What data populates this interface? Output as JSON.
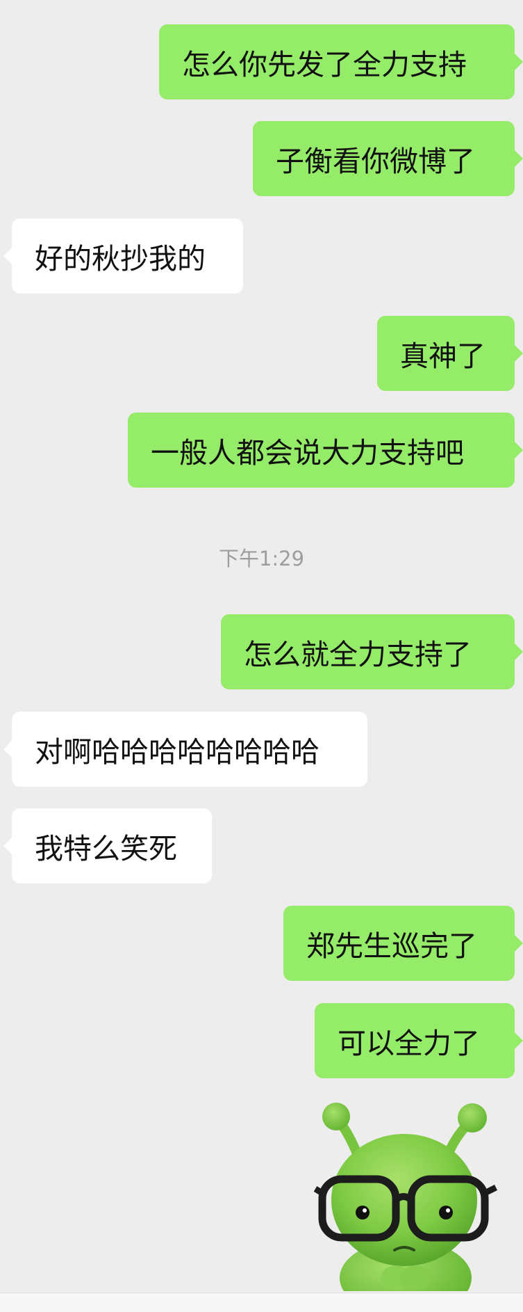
{
  "colors": {
    "background": "#ededed",
    "outgoing_bubble": "#95ec69",
    "incoming_bubble": "#ffffff",
    "timestamp_text": "#9d9d9d"
  },
  "messages": [
    {
      "direction": "out",
      "text": "怎么你先发了全力支持"
    },
    {
      "direction": "out",
      "text": "子衡看你微博了"
    },
    {
      "direction": "in",
      "text": "好的秋抄我的"
    },
    {
      "direction": "out",
      "text": "真神了"
    },
    {
      "direction": "out",
      "text": "一般人都会说大力支持吧"
    },
    {
      "direction": "out",
      "text": "怎么就全力支持了"
    },
    {
      "direction": "in",
      "text": "对啊哈哈哈哈哈哈哈哈"
    },
    {
      "direction": "in",
      "text": "我特么笑死"
    },
    {
      "direction": "out",
      "text": "郑先生巡完了"
    },
    {
      "direction": "out",
      "text": "可以全力了"
    }
  ],
  "timestamp": "下午1:29",
  "sticker": {
    "icon": "green-alien-with-glasses-sticker"
  }
}
